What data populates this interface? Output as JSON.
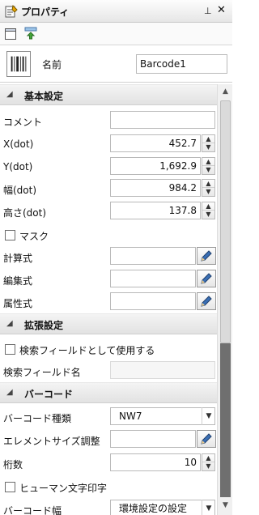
{
  "titlebar": {
    "title": "プロパティ",
    "pin_glyph": "⊥",
    "close_glyph": "✕"
  },
  "header": {
    "name_label": "名前",
    "name_value": "Barcode1"
  },
  "categories": {
    "basic": "基本設定",
    "extended": "拡張設定",
    "barcode": "バーコード"
  },
  "props": {
    "comment": {
      "label": "コメント",
      "value": ""
    },
    "x": {
      "label": "X(dot)",
      "value": "452.7"
    },
    "y": {
      "label": "Y(dot)",
      "value": "1,692.9"
    },
    "width": {
      "label": "幅(dot)",
      "value": "984.2"
    },
    "height": {
      "label": "高さ(dot)",
      "value": "137.8"
    },
    "mask": {
      "label": "マスク",
      "checked": false
    },
    "calc": {
      "label": "計算式",
      "value": ""
    },
    "edit": {
      "label": "編集式",
      "value": ""
    },
    "attr": {
      "label": "属性式",
      "value": ""
    },
    "use_search": {
      "label": "検索フィールドとして使用する",
      "checked": false
    },
    "search_name": {
      "label": "検索フィールド名",
      "value": ""
    },
    "barcode_type": {
      "label": "バーコード種類",
      "value": "NW7"
    },
    "element_size": {
      "label": "エレメントサイズ調整",
      "value": ""
    },
    "digits": {
      "label": "桁数",
      "value": "10"
    },
    "human_readable": {
      "label": "ヒューマン文字印字",
      "checked": false
    },
    "barcode_width": {
      "label": "バーコード幅",
      "value": "環境設定の設定"
    }
  }
}
